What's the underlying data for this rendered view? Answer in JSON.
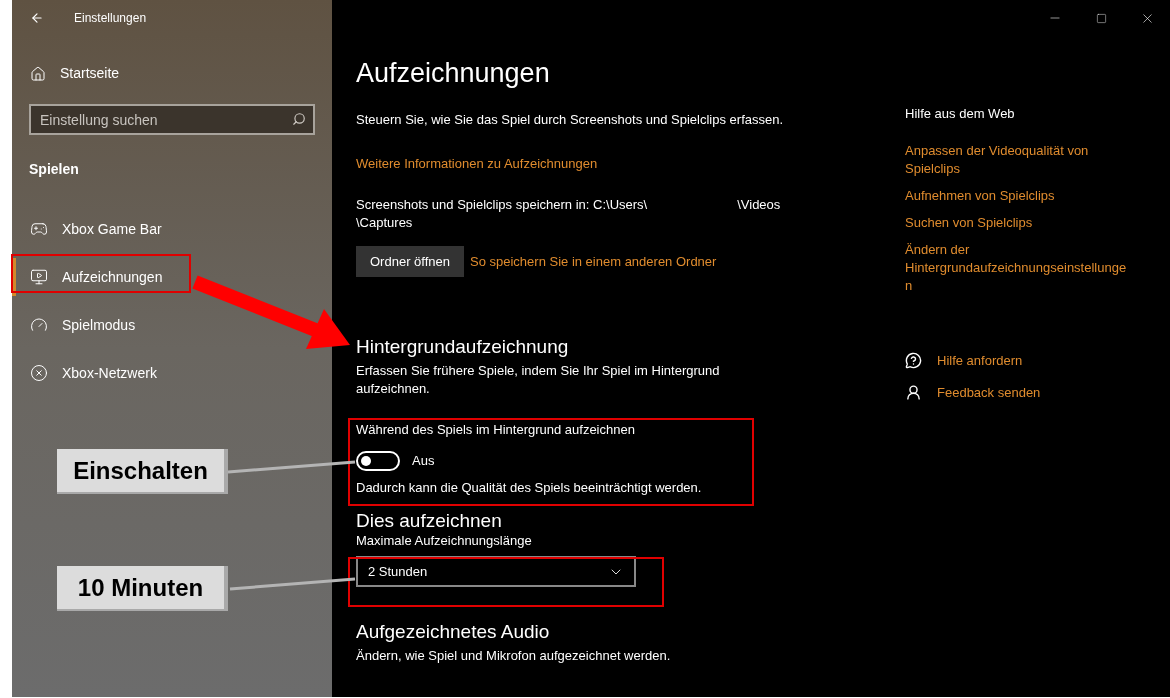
{
  "window": {
    "title": "Einstellungen"
  },
  "sidebar": {
    "home": "Startseite",
    "search": {
      "placeholder": "Einstellung suchen"
    },
    "section": "Spielen",
    "items": [
      {
        "label": "Xbox Game Bar",
        "kind": "gamebar",
        "selected": false
      },
      {
        "label": "Aufzeichnungen",
        "kind": "captures",
        "selected": true
      },
      {
        "label": "Spielmodus",
        "kind": "gamemode",
        "selected": false
      },
      {
        "label": "Xbox-Netzwerk",
        "kind": "network",
        "selected": false
      }
    ]
  },
  "page": {
    "title": "Aufzeichnungen",
    "description": "Steuern Sie, wie Sie das Spiel durch Screenshots und Spielclips erfassen.",
    "more_link": "Weitere Informationen zu Aufzeichnungen",
    "path_start": "Screenshots und Spielclips speichern in: C:\\Users\\",
    "path_mid": "\\Videos",
    "path_end": "\\Captures",
    "open_button": "Ordner öffnen",
    "other_folder_link": "So speichern Sie in einem anderen Ordner",
    "background": {
      "heading": "Hintergrundaufzeichnung",
      "description": "Erfassen Sie frühere Spiele, indem Sie Ihr Spiel im Hintergrund aufzeichnen.",
      "toggle_label": "Während des Spiels im Hintergrund aufzeichnen",
      "toggle": {
        "on": false,
        "state": "Aus"
      },
      "note": "Dadurch kann die Qualität des Spiels beeinträchtigt werden."
    },
    "record": {
      "heading": "Dies aufzeichnen",
      "label": "Maximale Aufzeichnungslänge",
      "dropdown": {
        "value": "2 Stunden"
      }
    },
    "audio": {
      "heading": "Aufgezeichnetes Audio",
      "description": "Ändern, wie Spiel und Mikrofon aufgezeichnet werden."
    }
  },
  "help": {
    "heading": "Hilfe aus dem Web",
    "links": [
      "Anpassen der Videoqualität von Spielclips",
      "Aufnehmen von Spielclips",
      "Suchen von Spielclips",
      "Ändern der Hintergrundaufzeichnungseinstellungen"
    ],
    "actions": [
      {
        "label": "Hilfe anfordern",
        "kind": "help"
      },
      {
        "label": "Feedback senden",
        "kind": "feedback"
      }
    ]
  },
  "annotations": [
    {
      "label": "Einschalten"
    },
    {
      "label": "10 Minuten"
    }
  ]
}
